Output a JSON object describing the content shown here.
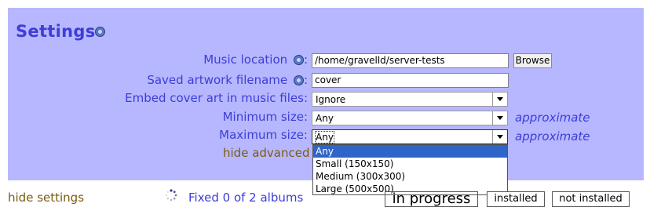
{
  "settings": {
    "title": "Settings",
    "fields": {
      "music_location": {
        "label": "Music location",
        "value": "/home/gravelld/server-tests",
        "button": "Browse"
      },
      "artwork_filename": {
        "label": "Saved artwork filename",
        "value": "cover"
      },
      "embed_cover": {
        "label": "Embed cover art in music files:",
        "value": "Ignore"
      },
      "min_size": {
        "label": "Minimum size:",
        "value": "Any",
        "note": "approximate"
      },
      "max_size": {
        "label": "Maximum size:",
        "value": "Any",
        "note": "approximate"
      }
    },
    "label_colon": ":",
    "hide_advanced": "hide advanced",
    "dropdown_options": [
      "Any",
      "Small (150x150)",
      "Medium (300x300)",
      "Large (500x500)"
    ],
    "dropdown_selected": "Any"
  },
  "footer": {
    "hide_settings": "hide settings",
    "status": "Fixed 0 of 2 albums",
    "progress_label": "in progress",
    "installed_label": "installed",
    "not_installed_label": "not installed"
  },
  "icons": {
    "help": "help-icon",
    "spinner": "loading-spinner-icon",
    "dropdown_arrow": "chevron-down-icon"
  },
  "colors": {
    "panel_bg": "#b7b7ff",
    "label_text": "#3d3dd8",
    "link_text": "#7a5c10",
    "selection": "#2f64c8"
  }
}
